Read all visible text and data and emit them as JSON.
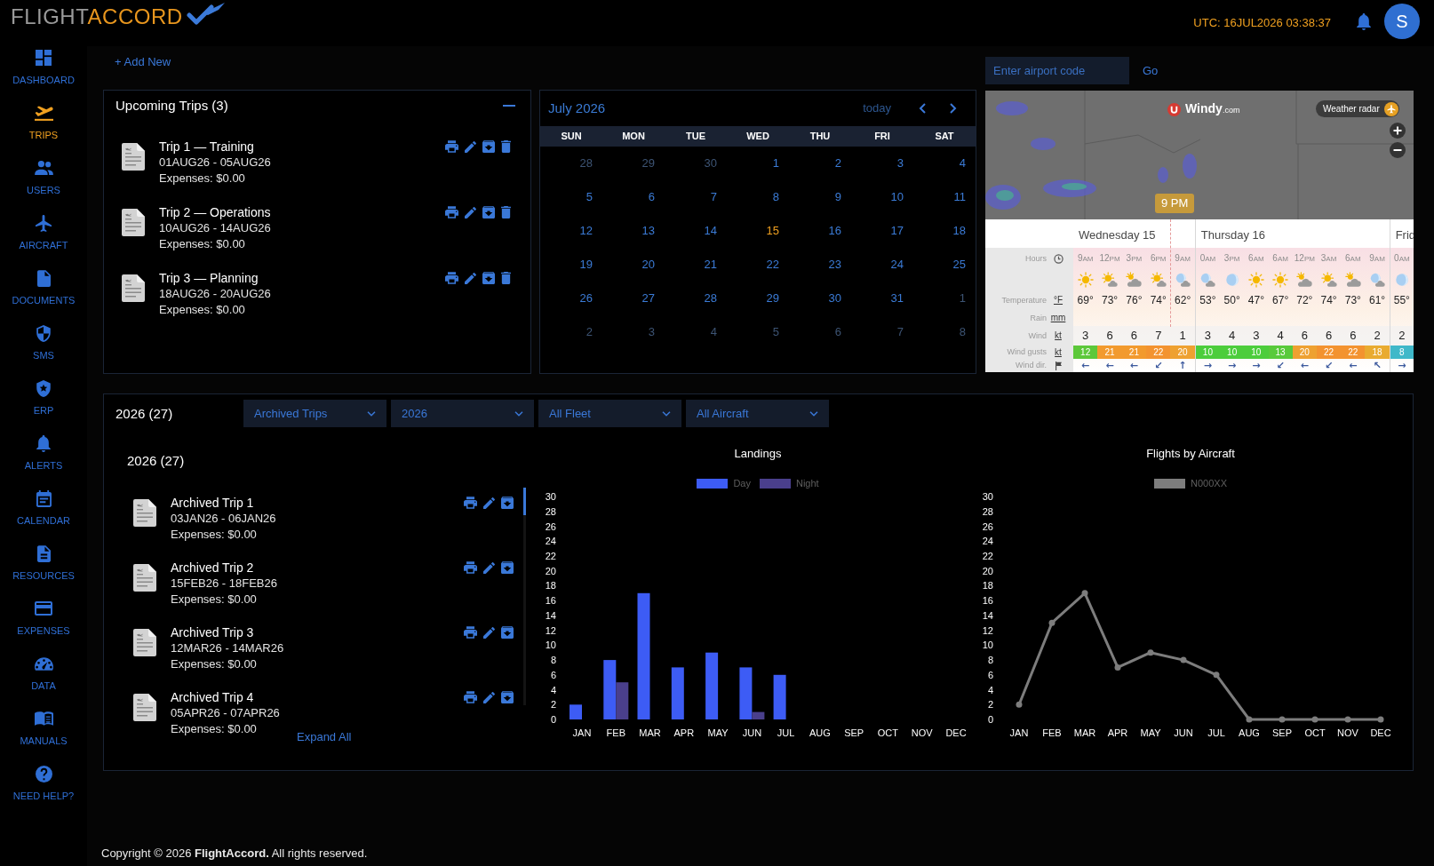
{
  "header": {
    "logo": {
      "part_1": "FLIGHT",
      "part_2": "ACCORD"
    },
    "utc_clock": "UTC: 16JUL2026 03:38:37",
    "avatar_initial": "S"
  },
  "sidebar": {
    "items": [
      {
        "label": "DASHBOARD",
        "selected": false
      },
      {
        "label": "TRIPS",
        "selected": true
      },
      {
        "label": "USERS",
        "selected": false
      },
      {
        "label": "AIRCRAFT",
        "selected": false
      },
      {
        "label": "DOCUMENTS",
        "selected": false
      },
      {
        "label": "SMS",
        "selected": false
      },
      {
        "label": "ERP",
        "selected": false
      },
      {
        "label": "ALERTS",
        "selected": false
      },
      {
        "label": "CALENDAR",
        "selected": false
      },
      {
        "label": "RESOURCES",
        "selected": false
      },
      {
        "label": "EXPENSES",
        "selected": false
      },
      {
        "label": "DATA",
        "selected": false
      },
      {
        "label": "MANUALS",
        "selected": false
      },
      {
        "label": "NEED HELP?",
        "selected": false
      }
    ]
  },
  "add_new": "+ Add New",
  "upcoming_trips": {
    "title": "Upcoming Trips (3)",
    "trips": [
      {
        "title": "Trip 1 — Training",
        "dates": "01AUG26 - 05AUG26",
        "expenses": "Expenses: $0.00",
        "deletable": true
      },
      {
        "title": "Trip 2 — Operations",
        "dates": "10AUG26 - 14AUG26",
        "expenses": "Expenses: $0.00",
        "deletable": true
      },
      {
        "title": "Trip 3 — Planning",
        "dates": "18AUG26 - 20AUG26",
        "expenses": "Expenses: $0.00",
        "deletable": true
      }
    ]
  },
  "calendar": {
    "title": "July 2026",
    "today_button": "today",
    "weekdays": [
      "SUN",
      "MON",
      "TUE",
      "WED",
      "THU",
      "FRI",
      "SAT"
    ],
    "weeks": [
      {
        "days": [
          {
            "day": "28",
            "outside_month": true,
            "today": false
          },
          {
            "day": "29",
            "outside_month": true,
            "today": false
          },
          {
            "day": "30",
            "outside_month": true,
            "today": false
          },
          {
            "day": "1",
            "outside_month": false,
            "today": false
          },
          {
            "day": "2",
            "outside_month": false,
            "today": false
          },
          {
            "day": "3",
            "outside_month": false,
            "today": false
          },
          {
            "day": "4",
            "outside_month": false,
            "today": false
          }
        ]
      },
      {
        "days": [
          {
            "day": "5",
            "outside_month": false,
            "today": false
          },
          {
            "day": "6",
            "outside_month": false,
            "today": false
          },
          {
            "day": "7",
            "outside_month": false,
            "today": false
          },
          {
            "day": "8",
            "outside_month": false,
            "today": false
          },
          {
            "day": "9",
            "outside_month": false,
            "today": false
          },
          {
            "day": "10",
            "outside_month": false,
            "today": false
          },
          {
            "day": "11",
            "outside_month": false,
            "today": false
          }
        ]
      },
      {
        "days": [
          {
            "day": "12",
            "outside_month": false,
            "today": false
          },
          {
            "day": "13",
            "outside_month": false,
            "today": false
          },
          {
            "day": "14",
            "outside_month": false,
            "today": false
          },
          {
            "day": "15",
            "outside_month": false,
            "today": true
          },
          {
            "day": "16",
            "outside_month": false,
            "today": false
          },
          {
            "day": "17",
            "outside_month": false,
            "today": false
          },
          {
            "day": "18",
            "outside_month": false,
            "today": false
          }
        ]
      },
      {
        "days": [
          {
            "day": "19",
            "outside_month": false,
            "today": false
          },
          {
            "day": "20",
            "outside_month": false,
            "today": false
          },
          {
            "day": "21",
            "outside_month": false,
            "today": false
          },
          {
            "day": "22",
            "outside_month": false,
            "today": false
          },
          {
            "day": "23",
            "outside_month": false,
            "today": false
          },
          {
            "day": "24",
            "outside_month": false,
            "today": false
          },
          {
            "day": "25",
            "outside_month": false,
            "today": false
          }
        ]
      },
      {
        "days": [
          {
            "day": "26",
            "outside_month": false,
            "today": false
          },
          {
            "day": "27",
            "outside_month": false,
            "today": false
          },
          {
            "day": "28",
            "outside_month": false,
            "today": false
          },
          {
            "day": "29",
            "outside_month": false,
            "today": false
          },
          {
            "day": "30",
            "outside_month": false,
            "today": false
          },
          {
            "day": "31",
            "outside_month": false,
            "today": false
          },
          {
            "day": "1",
            "outside_month": true,
            "today": false
          }
        ]
      },
      {
        "days": [
          {
            "day": "2",
            "outside_month": true,
            "today": false
          },
          {
            "day": "3",
            "outside_month": true,
            "today": false
          },
          {
            "day": "4",
            "outside_month": true,
            "today": false
          },
          {
            "day": "5",
            "outside_month": true,
            "today": false
          },
          {
            "day": "6",
            "outside_month": true,
            "today": false
          },
          {
            "day": "7",
            "outside_month": true,
            "today": false
          },
          {
            "day": "8",
            "outside_month": true,
            "today": false
          }
        ]
      }
    ]
  },
  "airport_search": {
    "placeholder": "Enter airport code",
    "button": "Go"
  },
  "weather": {
    "brand": "Windy",
    "brand_suffix": ".com",
    "radar_button": "Weather radar",
    "time_marker": "9 PM",
    "labels": {
      "hours": "Hours",
      "temperature": "Temperature",
      "temperature_unit": "°F",
      "rain": "Rain",
      "rain_unit": "mm",
      "wind": "Wind",
      "wind_unit": "kt",
      "gusts": "Wind gusts",
      "gusts_unit": "kt",
      "wind_dir": "Wind dir."
    },
    "days": [
      {
        "label": "Wednesday 15",
        "columns": [
          {
            "hour": "9",
            "period": "AM",
            "kind": "sun",
            "temp": "69°",
            "wind": "3",
            "gust": {
              "value": "12",
              "color": "#5cc83a"
            },
            "dir": "←"
          },
          {
            "hour": "12",
            "period": "PM",
            "kind": "sun_cloud",
            "temp": "73°",
            "wind": "6",
            "gust": {
              "value": "21",
              "color": "#f29a2e"
            },
            "dir": "←"
          },
          {
            "hour": "3",
            "period": "PM",
            "kind": "cloud_sun",
            "temp": "76°",
            "wind": "6",
            "gust": {
              "value": "21",
              "color": "#f29a2e"
            },
            "dir": "←"
          },
          {
            "hour": "6",
            "period": "PM",
            "kind": "sun_cloud",
            "temp": "74°",
            "wind": "7",
            "gust": {
              "value": "22",
              "color": "#f39330"
            },
            "dir": "↙"
          },
          {
            "hour": "9",
            "period": "AM",
            "kind": "moon_cloud",
            "temp": "62°",
            "wind": "1",
            "gust": {
              "value": "20",
              "color": "#eea131"
            },
            "dir": "↑"
          }
        ]
      },
      {
        "label": "Thursday 16",
        "columns": [
          {
            "hour": "0",
            "period": "AM",
            "kind": "moon_cloud",
            "temp": "53°",
            "wind": "3",
            "gust": {
              "value": "10",
              "color": "#4ccd3c"
            },
            "dir": "→"
          },
          {
            "hour": "3",
            "period": "PM",
            "kind": "moon",
            "temp": "50°",
            "wind": "4",
            "gust": {
              "value": "10",
              "color": "#4ccd3c"
            },
            "dir": "→"
          },
          {
            "hour": "6",
            "period": "AM",
            "kind": "sun",
            "temp": "47°",
            "wind": "3",
            "gust": {
              "value": "10",
              "color": "#4ccd3c"
            },
            "dir": "→"
          },
          {
            "hour": "6",
            "period": "AM",
            "kind": "sun",
            "temp": "67°",
            "wind": "4",
            "gust": {
              "value": "13",
              "color": "#58ca3b"
            },
            "dir": "↙"
          },
          {
            "hour": "12",
            "period": "PM",
            "kind": "cloud_sun",
            "temp": "72°",
            "wind": "6",
            "gust": {
              "value": "20",
              "color": "#eea131"
            },
            "dir": "←"
          },
          {
            "hour": "3",
            "period": "AM",
            "kind": "sun_cloud",
            "temp": "74°",
            "wind": "6",
            "gust": {
              "value": "22",
              "color": "#f39330"
            },
            "dir": "↙"
          },
          {
            "hour": "6",
            "period": "AM",
            "kind": "cloud_sun",
            "temp": "73°",
            "wind": "6",
            "gust": {
              "value": "22",
              "color": "#f39330"
            },
            "dir": "←"
          },
          {
            "hour": "9",
            "period": "AM",
            "kind": "moon_cloud",
            "temp": "61°",
            "wind": "2",
            "gust": {
              "value": "18",
              "color": "#e9ab30"
            },
            "dir": "↖"
          }
        ]
      },
      {
        "label": "Frid",
        "columns": [
          {
            "hour": "0",
            "period": "AM",
            "kind": "moon",
            "temp": "55°",
            "wind": "2",
            "gust": {
              "value": "8",
              "color": "#3fb8c9"
            },
            "dir": "→"
          }
        ]
      }
    ]
  },
  "archive": {
    "title": "2026 (27)",
    "filters": [
      "Archived Trips",
      "2026",
      "All Fleet",
      "All Aircraft"
    ],
    "list_title": "2026 (27)",
    "trips": [
      {
        "title": "Archived Trip 1",
        "dates": "03JAN26 - 06JAN26",
        "expenses": "Expenses: $0.00",
        "deletable": false
      },
      {
        "title": "Archived Trip 2",
        "dates": "15FEB26 - 18FEB26",
        "expenses": "Expenses: $0.00",
        "deletable": false
      },
      {
        "title": "Archived Trip 3",
        "dates": "12MAR26 - 14MAR26",
        "expenses": "Expenses: $0.00",
        "deletable": false
      },
      {
        "title": "Archived Trip 4",
        "dates": "05APR26 - 07APR26",
        "expenses": "Expenses: $0.00",
        "deletable": false
      }
    ],
    "expand_all": "Expand All",
    "charts": [
      {
        "chart_data": {
          "type": "bar",
          "title": "Landings",
          "legend": "top",
          "categories": [
            "JAN",
            "FEB",
            "MAR",
            "APR",
            "MAY",
            "JUN",
            "JUL",
            "AUG",
            "SEP",
            "OCT",
            "NOV",
            "DEC"
          ],
          "series": [
            {
              "name": "Day",
              "color": "#3d5cf5",
              "values": [
                2,
                8,
                17,
                7,
                9,
                7,
                6,
                0,
                0,
                0,
                0,
                0
              ]
            },
            {
              "name": "Night",
              "color": "#4a3f8c",
              "values": [
                0,
                5,
                0,
                0,
                0,
                1,
                0,
                0,
                0,
                0,
                0,
                0
              ]
            }
          ],
          "ylim": [
            0,
            30
          ],
          "yticks": [
            0,
            2,
            4,
            6,
            8,
            10,
            12,
            14,
            16,
            18,
            20,
            22,
            24,
            26,
            28,
            30
          ]
        }
      },
      {
        "chart_data": {
          "type": "line",
          "title": "Flights by Aircraft",
          "legend": "top",
          "categories": [
            "JAN",
            "FEB",
            "MAR",
            "APR",
            "MAY",
            "JUN",
            "JUL",
            "AUG",
            "SEP",
            "OCT",
            "NOV",
            "DEC"
          ],
          "series": [
            {
              "name": "N000XX",
              "color": "#7d7d7d",
              "marker": "circle",
              "values": [
                2,
                13,
                17,
                7,
                9,
                8,
                6,
                0,
                0,
                0,
                0,
                0
              ]
            }
          ],
          "ylim": [
            0,
            30
          ],
          "yticks": [
            0,
            2,
            4,
            6,
            8,
            10,
            12,
            14,
            16,
            18,
            20,
            22,
            24,
            26,
            28,
            30
          ]
        }
      }
    ]
  },
  "footer": "Copyright © 2026 **FlightAccord.** All rights reserved."
}
